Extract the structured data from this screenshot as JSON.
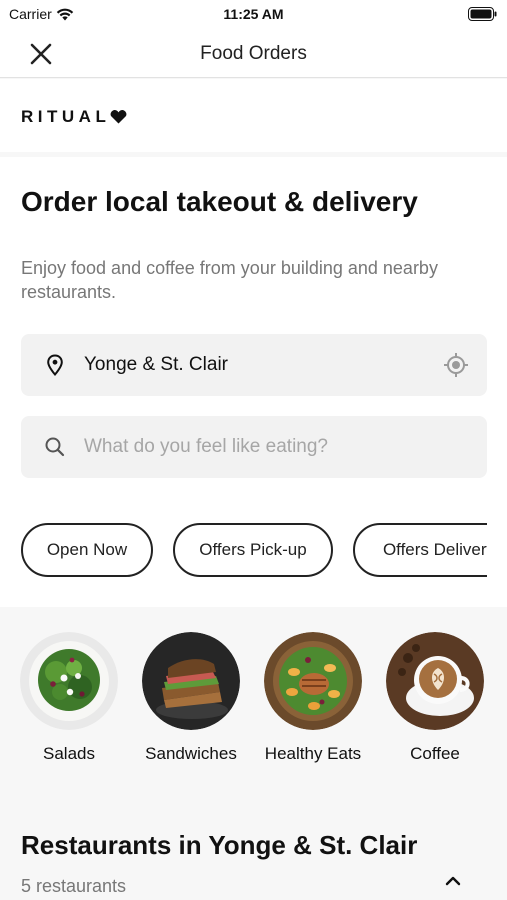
{
  "status_bar": {
    "carrier": "Carrier",
    "time": "11:25 AM"
  },
  "nav": {
    "title": "Food Orders",
    "close_icon": "close-icon"
  },
  "brand": {
    "name": "RITUAL",
    "mark_icon": "heart-icon"
  },
  "hero": {
    "title": "Order local takeout & delivery",
    "subtitle": "Enjoy food and coffee from your building and nearby restaurants."
  },
  "location": {
    "value": "Yonge & St. Clair",
    "icon": "location-pin-icon",
    "locate_icon": "crosshair-icon"
  },
  "search": {
    "placeholder": "What do you feel like eating?",
    "icon": "search-icon"
  },
  "filters": [
    {
      "label": "Open Now"
    },
    {
      "label": "Offers Pick-up"
    },
    {
      "label": "Offers Delivery"
    }
  ],
  "categories": [
    {
      "label": "Salads"
    },
    {
      "label": "Sandwiches"
    },
    {
      "label": "Healthy Eats"
    },
    {
      "label": "Coffee"
    }
  ],
  "restaurants": {
    "title": "Restaurants in Yonge & St. Clair",
    "count": "5 restaurants",
    "toggle_icon": "chevron-up-icon"
  },
  "colors": {
    "accent": "#111111",
    "background": "#f7f7f7",
    "field": "#f2f2f2",
    "muted": "#777777"
  }
}
